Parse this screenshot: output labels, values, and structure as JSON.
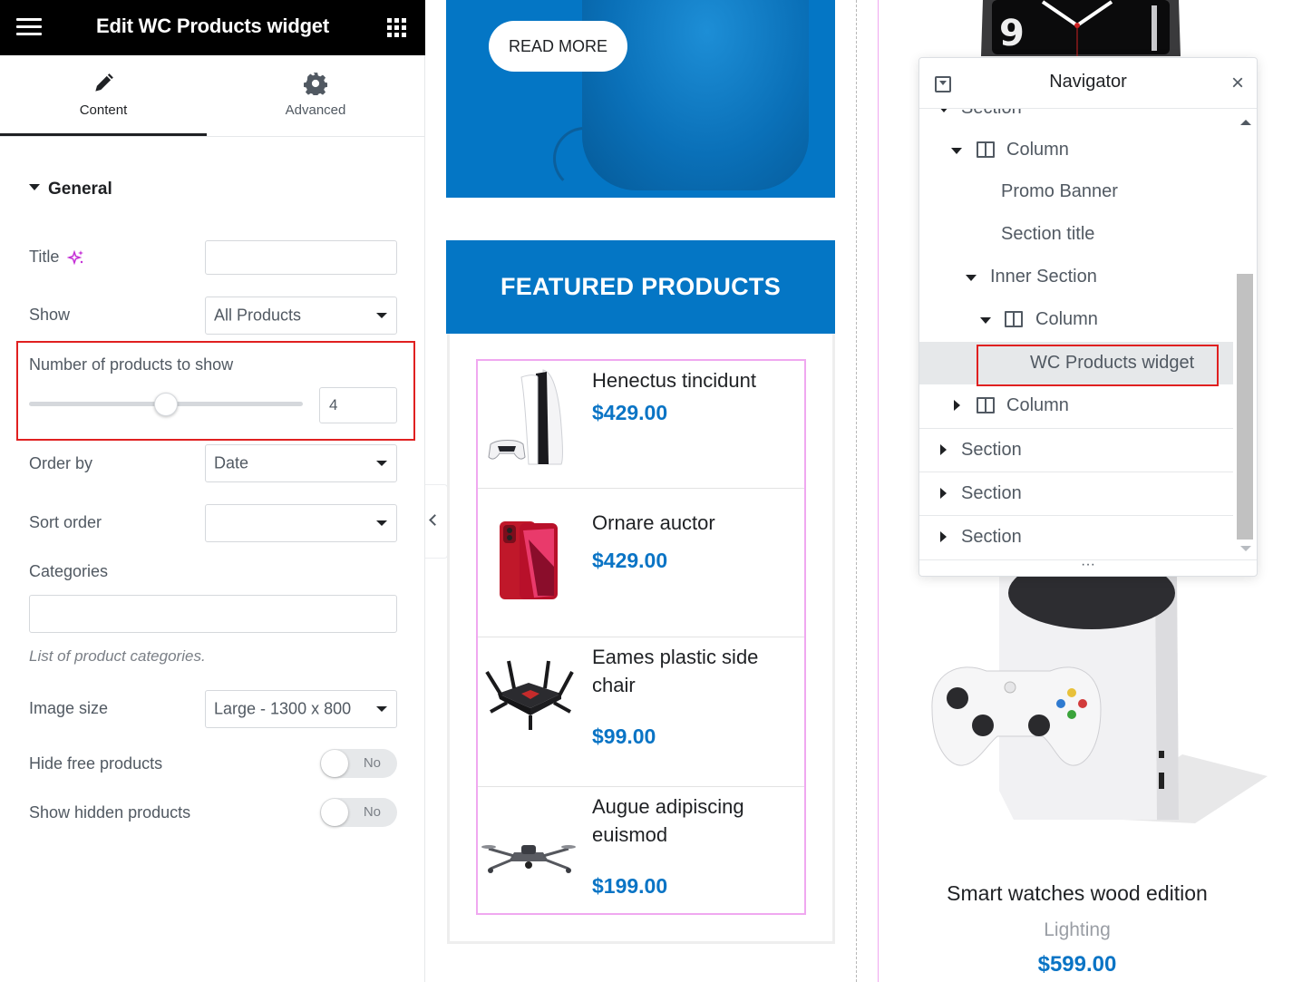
{
  "panel": {
    "header_title": "Edit WC Products widget",
    "tabs": [
      {
        "label": "Content",
        "icon": "pencil-icon",
        "active": true
      },
      {
        "label": "Advanced",
        "icon": "gear-icon",
        "active": false
      }
    ],
    "section_title": "General",
    "controls": {
      "title_label": "Title",
      "title_value": "",
      "show_label": "Show",
      "show_value": "All Products",
      "number_label": "Number of products to show",
      "number_value": "4",
      "number_slider_fraction": 0.5,
      "orderby_label": "Order by",
      "orderby_value": "Date",
      "sortorder_label": "Sort order",
      "sortorder_value": "",
      "categories_label": "Categories",
      "categories_value": "",
      "categories_hint": "List of product categories.",
      "imagesize_label": "Image size",
      "imagesize_value": "Large - 1300 x 800",
      "hidefree_label": "Hide free products",
      "hidefree_value": "No",
      "showhidden_label": "Show hidden products",
      "showhidden_value": "No"
    }
  },
  "canvas": {
    "banner_button": "READ MORE",
    "featured_title": "FEATURED PRODUCTS",
    "products": [
      {
        "name": "Henectus tincidunt",
        "price": "$429.00",
        "icon": "game-console-icon"
      },
      {
        "name": "Ornare auctor",
        "price": "$429.00",
        "icon": "smartphone-icon"
      },
      {
        "name": "Eames plastic side chair",
        "price": "$99.00",
        "icon": "router-icon"
      },
      {
        "name": "Augue adipiscing euismod",
        "price": "$199.00",
        "icon": "drone-icon"
      }
    ],
    "right_product": {
      "title": "Smart watches wood edition",
      "category": "Lighting",
      "price": "$599.00"
    }
  },
  "navigator": {
    "title": "Navigator",
    "items": [
      {
        "label": "Section"
      },
      {
        "label": "Column"
      },
      {
        "label": "Promo Banner"
      },
      {
        "label": "Section title"
      },
      {
        "label": "Inner Section"
      },
      {
        "label": "Column"
      },
      {
        "label": "WC Products widget",
        "selected": true
      },
      {
        "label": "Column"
      },
      {
        "label": "Section"
      },
      {
        "label": "Section"
      },
      {
        "label": "Section"
      }
    ],
    "footer": "···"
  },
  "colors": {
    "accent_blue": "#0476c5",
    "price_blue": "#0a74c5",
    "highlight_red": "#e02020",
    "ai_sparkle": "#c42fd6"
  }
}
